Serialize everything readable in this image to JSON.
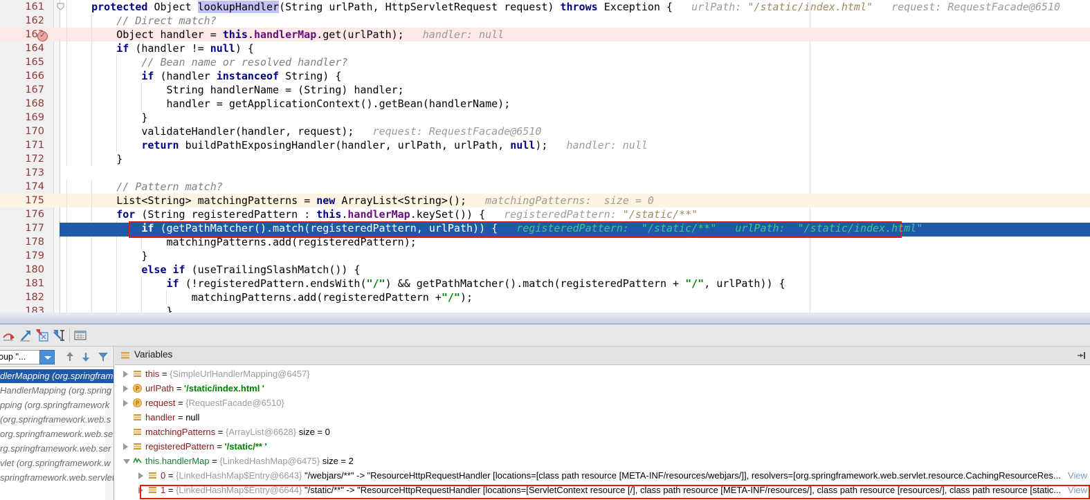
{
  "editor": {
    "right_margin_x": 1170,
    "lines": [
      {
        "num": "161",
        "text": "    protected Object lookupHandler(String urlPath, HttpServletRequest request) throws Exception {   urlPath: \"/static/index.html\"   request: RequestFacade@6510"
      },
      {
        "num": "162",
        "text": "        // Direct match?"
      },
      {
        "num": "163",
        "text": "        Object handler = this.handlerMap.get(urlPath);   handler: null"
      },
      {
        "num": "164",
        "text": "        if (handler != null) {"
      },
      {
        "num": "165",
        "text": "            // Bean name or resolved handler?"
      },
      {
        "num": "166",
        "text": "            if (handler instanceof String) {"
      },
      {
        "num": "167",
        "text": "                String handlerName = (String) handler;"
      },
      {
        "num": "168",
        "text": "                handler = getApplicationContext().getBean(handlerName);"
      },
      {
        "num": "169",
        "text": "            }"
      },
      {
        "num": "170",
        "text": "            validateHandler(handler, request);   request: RequestFacade@6510"
      },
      {
        "num": "171",
        "text": "            return buildPathExposingHandler(handler, urlPath, urlPath, null);   handler: null"
      },
      {
        "num": "172",
        "text": "        }"
      },
      {
        "num": "173",
        "text": ""
      },
      {
        "num": "174",
        "text": "        // Pattern match?"
      },
      {
        "num": "175",
        "text": "        List<String> matchingPatterns = new ArrayList<String>();   matchingPatterns:  size = 0"
      },
      {
        "num": "176",
        "text": "        for (String registeredPattern : this.handlerMap.keySet()) {   registeredPattern: \"/static/**\""
      },
      {
        "num": "177",
        "text": "            if (getPathMatcher().match(registeredPattern, urlPath)) {   registeredPattern:  \"/static/**\"   urlPath:  \"/static/index.html\""
      },
      {
        "num": "178",
        "text": "                matchingPatterns.add(registeredPattern);"
      },
      {
        "num": "179",
        "text": "            }"
      },
      {
        "num": "180",
        "text": "            else if (useTrailingSlashMatch()) {"
      },
      {
        "num": "181",
        "text": "                if (!registeredPattern.endsWith(\"/\") && getPathMatcher().match(registeredPattern + \"/\", urlPath)) {"
      },
      {
        "num": "182",
        "text": "                    matchingPatterns.add(registeredPattern +\"/\");"
      },
      {
        "num": "183",
        "text": "                }"
      }
    ],
    "selected_line": "177",
    "breakpoint_line": "163",
    "execution_line": "175",
    "search_highlight": "lookupHandler",
    "colors": {
      "selection": "#1f59a8",
      "annotation_box": "#e01b13",
      "keyword": "#000080",
      "string": "#008000",
      "comment": "#808080",
      "field": "#660e7a",
      "hint": "#9b9b9b",
      "hint_selected": "#39c98c",
      "line_number": "#8b3a3a",
      "exec_line_bg": "#fdf4e3",
      "breakpoint_line_bg": "#fbe8e7"
    }
  },
  "debug_toolbar": {
    "buttons": [
      {
        "name": "step-over-icon",
        "tooltip": "Step Over"
      },
      {
        "name": "step-into-icon",
        "tooltip": "Step Into"
      },
      {
        "name": "force-step-into-icon",
        "tooltip": "Force Step Into"
      },
      {
        "name": "step-out-icon",
        "tooltip": "Step Out"
      },
      {
        "name": "evaluate-expression-icon",
        "tooltip": "Evaluate Expression"
      }
    ]
  },
  "frames": {
    "thread_selector_value": "group \"...",
    "toolbar_icons": [
      "arrow-up-icon",
      "arrow-down-icon",
      "filter-icon"
    ],
    "rows": [
      {
        "text": "dlerMapping (org.springfram",
        "selected": true
      },
      {
        "text": "HandlerMapping (org.spring",
        "selected": false
      },
      {
        "text": "pping (org.springframework",
        "selected": false
      },
      {
        "text": "(org.springframework.web.s",
        "selected": false
      },
      {
        "text": "org.springframework.web.se",
        "selected": false
      },
      {
        "text": "rg.springframework.web.ser",
        "selected": false
      },
      {
        "text": "vlet (org.springframework.w",
        "selected": false
      },
      {
        "text": "springframework.web.servlet",
        "selected": false
      }
    ]
  },
  "variables": {
    "header": "Variables",
    "header_icon": "variables-icon",
    "collapse_icon": "collapse-panel-icon",
    "rows": [
      {
        "indent": 0,
        "arrow": "closed",
        "icon": "field-icon",
        "name": "this",
        "eq": " = ",
        "ref": "{SimpleUrlHandlerMapping@6457}",
        "value": "",
        "value_kind": "none",
        "extra": "",
        "highlight": false
      },
      {
        "indent": 0,
        "arrow": "closed",
        "icon": "param-icon",
        "name": "urlPath",
        "eq": " = ",
        "ref": "",
        "value": "'/static/index.html '",
        "value_kind": "string",
        "extra": "",
        "highlight": false
      },
      {
        "indent": 0,
        "arrow": "closed",
        "icon": "param-icon",
        "name": "request",
        "eq": " = ",
        "ref": "{RequestFacade@6510}",
        "value": "",
        "value_kind": "none",
        "extra": "",
        "highlight": false
      },
      {
        "indent": 0,
        "arrow": "none",
        "icon": "field-icon",
        "name": "handler",
        "eq": " = ",
        "ref": "",
        "value": "null",
        "value_kind": "null",
        "extra": "",
        "highlight": false
      },
      {
        "indent": 0,
        "arrow": "none",
        "icon": "field-icon",
        "name": "matchingPatterns",
        "eq": " = ",
        "ref": "{ArrayList@6628}",
        "value": "",
        "value_kind": "none",
        "extra": "size = 0",
        "highlight": false
      },
      {
        "indent": 0,
        "arrow": "closed",
        "icon": "field-icon",
        "name": "registeredPattern",
        "eq": " = ",
        "ref": "",
        "value": "'/static/** '",
        "value_kind": "string",
        "extra": "",
        "highlight": false
      },
      {
        "indent": 0,
        "arrow": "open",
        "icon": "watch-icon",
        "name": "this.handlerMap",
        "eq": " = ",
        "ref": "{LinkedHashMap@6475}",
        "value": "",
        "value_kind": "none",
        "extra": "size = 2",
        "highlight": false,
        "name_green": true
      },
      {
        "indent": 1,
        "arrow": "closed",
        "icon": "entry-icon",
        "name": "0",
        "eq": " = ",
        "ref": "{LinkedHashMap$Entry@6643}",
        "value": "\"/webjars/**\" -> \"ResourceHttpRequestHandler [locations=[class path resource [META-INF/resources/webjars/]], resolvers=[org.springframework.web.servlet.resource.CachingResourceRes...",
        "value_kind": "plain",
        "extra": "",
        "view_link": "View",
        "highlight": false
      },
      {
        "indent": 1,
        "arrow": "closed",
        "icon": "entry-icon",
        "name": "1",
        "eq": " = ",
        "ref": "{LinkedHashMap$Entry@6644}",
        "value": "\"/static/**\" -> \"ResourceHttpRequestHandler [locations=[ServletContext resource [/], class path resource [META-INF/resources/], class path resource [resources/], class path resource [static...",
        "value_kind": "plain",
        "extra": "",
        "view_link": "View",
        "highlight": true
      }
    ]
  }
}
